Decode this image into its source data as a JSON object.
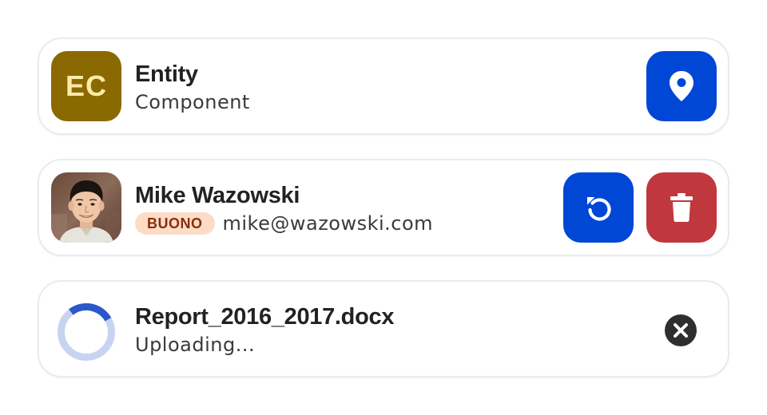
{
  "colors": {
    "entity_avatar_bg": "#8a6a00",
    "entity_avatar_text": "#fde9a8",
    "primary_action": "#0047d6",
    "danger_action": "#c0383e",
    "badge_bg": "#fcdcc6",
    "badge_text": "#8a2d0e",
    "spinner_track": "#c7d3f0",
    "spinner_arc": "#2a57c9",
    "close_icon": "#2e2e2e"
  },
  "entity_item": {
    "avatar_initials": "EC",
    "title": "Entity",
    "subtitle": "Component",
    "action_icon": "map-pin-icon"
  },
  "user_item": {
    "name": "Mike Wazowski",
    "badge": "BUONO",
    "email": "mike@wazowski.com",
    "actions": [
      {
        "icon": "undo-icon"
      },
      {
        "icon": "trash-icon"
      }
    ]
  },
  "upload_item": {
    "progress_icon": "spinner-icon",
    "filename": "Report_2016_2017.docx",
    "status": "Uploading...",
    "cancel_icon": "close-circle-icon"
  }
}
